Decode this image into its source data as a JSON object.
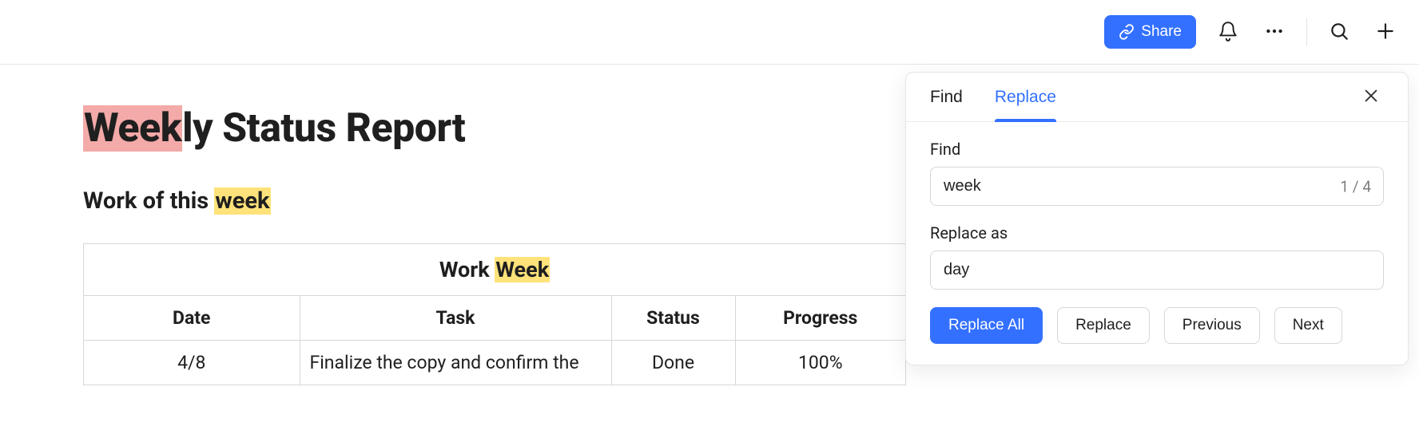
{
  "toolbar": {
    "share_label": "Share"
  },
  "doc": {
    "title_hl": "Week",
    "title_rest": "ly Status Report",
    "sub_prefix": "Work of this ",
    "sub_hl": "week",
    "table_title_prefix": "Work ",
    "table_title_hl": "Week",
    "columns": {
      "date": "Date",
      "task": "Task",
      "status": "Status",
      "progress": "Progress"
    },
    "rows": [
      {
        "date": "4/8",
        "task": "Finalize the copy and confirm the",
        "status": "Done",
        "progress": "100%"
      }
    ]
  },
  "panel": {
    "tabs": {
      "find": "Find",
      "replace": "Replace"
    },
    "find_label": "Find",
    "find_value": "week",
    "counter": "1 / 4",
    "replace_label": "Replace as",
    "replace_value": "day",
    "buttons": {
      "replace_all": "Replace All",
      "replace": "Replace",
      "previous": "Previous",
      "next": "Next"
    }
  }
}
